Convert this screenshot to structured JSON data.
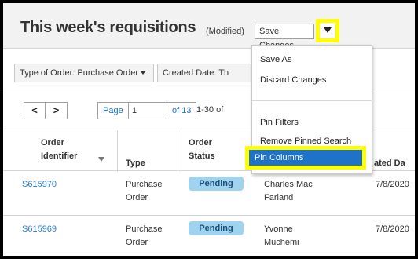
{
  "header": {
    "title": "This week's requisitions",
    "modified": "(Modified)",
    "save_changes": "Save Changes",
    "dropdown_icon": "caret-down-icon",
    "highlight_color": "#ffff00"
  },
  "filters": [
    {
      "label": "Type of Order: Purchase Order"
    },
    {
      "label": "Created Date: Th"
    }
  ],
  "pager": {
    "prev": "<",
    "next": ">",
    "page_label": "Page",
    "page_value": "1",
    "of_label": "of 13",
    "range": "1-30 of"
  },
  "columns": {
    "order_identifier": "Order Identifier",
    "type": "Type",
    "order_status": "Order Status",
    "created_date": "ated Da"
  },
  "rows": [
    {
      "id": "S615970",
      "type_l1": "Purchase",
      "type_l2": "Order",
      "status": "Pending",
      "name_l1": "Charles Mac",
      "name_l2": "Farland",
      "date": "7/8/2020"
    },
    {
      "id": "S615969",
      "type_l1": "Purchase",
      "type_l2": "Order",
      "status": "Pending",
      "name_l1": "Yvonne",
      "name_l2": "Muchemi",
      "date": "7/8/2020"
    }
  ],
  "menu": {
    "items": [
      "Save As",
      "Discard Changes",
      "Pin Filters",
      "Remove Pinned Search"
    ],
    "highlighted": "Pin Columns",
    "highlight_bg": "#1e73c8"
  }
}
